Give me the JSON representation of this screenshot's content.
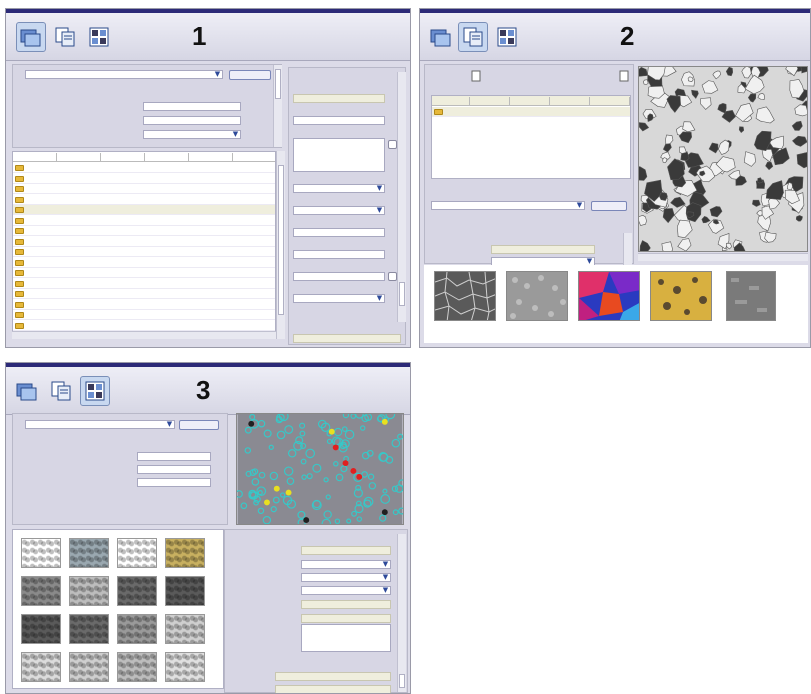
{
  "panels": [
    {
      "step_label": "1",
      "active_tool": "home-tool"
    },
    {
      "step_label": "2",
      "active_tool": "documents-tool"
    },
    {
      "step_label": "3",
      "active_tool": "report-tool"
    }
  ],
  "toolbar_icons": [
    "home-icon",
    "documents-icon",
    "report-icon"
  ],
  "colors": {
    "title_bar": "#2c2a78",
    "panel_bg": "#dcdbe8",
    "selected_row": "#efeedd",
    "folder": "#e6b83a",
    "overlay_cyan": "#37c8c8",
    "overlay_red": "#e02020",
    "overlay_yellow": "#e8e020"
  },
  "panel2_thumbnails": [
    "grain-boundary-image",
    "fine-grain-image",
    "color-phase-map",
    "yellow-phase-image",
    "gray-texture-image"
  ],
  "panel3_report_grid_rows": 4,
  "panel3_report_grid_cols": 4
}
